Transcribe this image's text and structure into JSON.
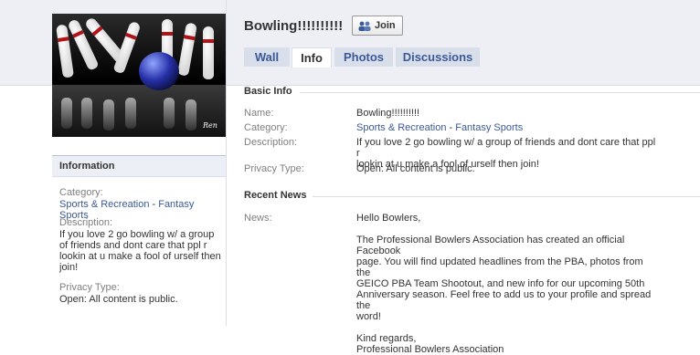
{
  "group": {
    "name": "Bowling!!!!!!!!!!",
    "join_label": "Join",
    "photo_signature": "Ren"
  },
  "tabs": [
    {
      "label": "Wall",
      "active": false
    },
    {
      "label": "Info",
      "active": true
    },
    {
      "label": "Photos",
      "active": false
    },
    {
      "label": "Discussions",
      "active": false
    }
  ],
  "sidebar": {
    "information_title": "Information",
    "category_label": "Category:",
    "category_main": "Sports & Recreation",
    "category_separator": " - ",
    "category_sub": "Fantasy Sports",
    "description_label": "Description:",
    "description_lines": [
      "If you love 2 go bowling w/ a group",
      "of friends and dont care that ppl r",
      "lookin at u make a fool of urself then",
      "join!"
    ],
    "privacy_label": "Privacy Type:",
    "privacy_value": "Open: All content is public."
  },
  "basic_info": {
    "title": "Basic Info",
    "name_label": "Name:",
    "name_value": "Bowling!!!!!!!!!!",
    "category_label": "Category:",
    "category_main": "Sports & Recreation",
    "category_separator": " - ",
    "category_sub": "Fantasy Sports",
    "description_label": "Description:",
    "description_lines": [
      "If you love 2 go bowling w/ a group of friends and dont care that ppl r",
      "lookin at u make a fool of urself then join!"
    ],
    "privacy_label": "Privacy Type:",
    "privacy_value": "Open: All content is public."
  },
  "recent_news": {
    "title": "Recent News",
    "news_label": "News:",
    "greeting": "Hello Bowlers,",
    "body_lines": [
      "The Professional Bowlers Association has created an official Facebook",
      "page. You will find updated headlines from the PBA, photos from the",
      "GEICO PBA Team Shootout, and new info for our upcoming 50th",
      "Anniversary season. Feel free to add us to your profile and spread the",
      "word!"
    ],
    "closing": "Kind regards,",
    "signature": "Professional Bowlers Association"
  },
  "colors": {
    "link": "#3b5998",
    "label_gray": "#808080",
    "tab_bg": "#d8dfea",
    "header_bg": "#edeff4"
  }
}
